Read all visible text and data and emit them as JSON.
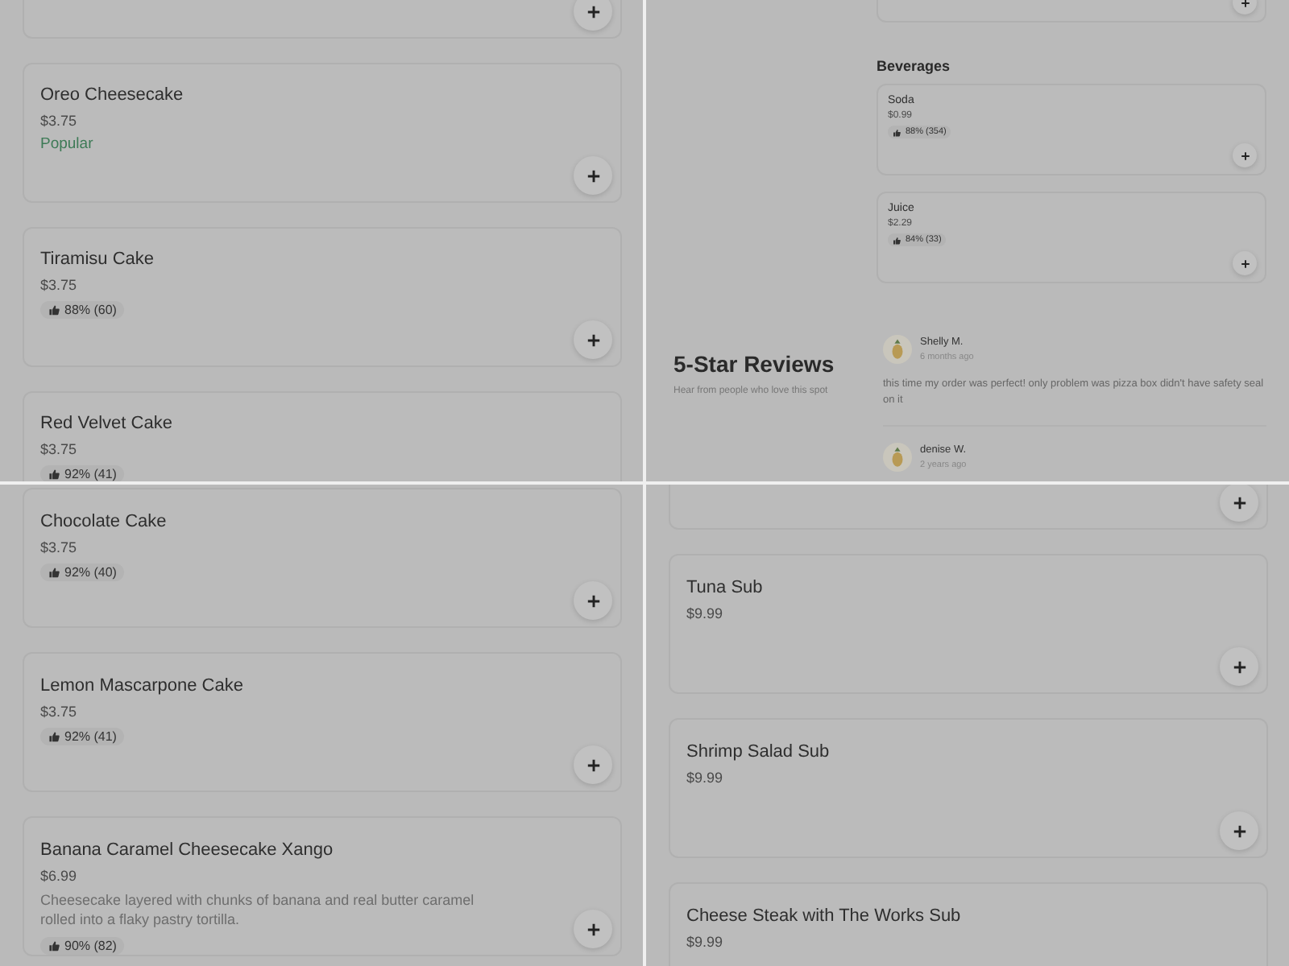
{
  "panels": [
    {
      "kind": "full",
      "blocks": [
        {
          "kind": "cut"
        },
        {
          "kind": "item",
          "name": "Oreo Cheesecake",
          "price": "$3.75",
          "tag": {
            "kind": "label",
            "text": "Popular"
          }
        },
        {
          "kind": "item",
          "name": "Tiramisu Cake",
          "price": "$3.75",
          "tag": {
            "kind": "rating",
            "text": "88% (60)"
          }
        },
        {
          "kind": "item",
          "name": "Red Velvet Cake",
          "price": "$3.75",
          "tag": {
            "kind": "rating",
            "text": "92% (41)"
          }
        }
      ]
    },
    {
      "kind": "split",
      "blocks": [
        {
          "kind": "cut"
        },
        {
          "kind": "heading",
          "text": "Beverages"
        },
        {
          "kind": "item",
          "name": "Soda",
          "price": "$0.99",
          "tag": {
            "kind": "rating",
            "text": "88% (354)"
          }
        },
        {
          "kind": "item",
          "name": "Juice",
          "price": "$2.29",
          "tag": {
            "kind": "rating",
            "text": "84% (33)"
          }
        },
        {
          "kind": "reviews",
          "title": "5-Star Reviews",
          "subtitle": "Hear from people who love this spot",
          "reviews": [
            {
              "author": "Shelly M.",
              "time": "6 months ago",
              "text": "this time my order was perfect! only problem was pizza box didn't have safety seal on it"
            },
            {
              "author": "denise W.",
              "time": "2 years ago"
            }
          ]
        }
      ]
    },
    {
      "kind": "full",
      "blocks": [
        {
          "kind": "item",
          "name": "Chocolate Cake",
          "price": "$3.75",
          "tag": {
            "kind": "rating",
            "text": "92% (40)"
          }
        },
        {
          "kind": "item",
          "name": "Lemon Mascarpone Cake",
          "price": "$3.75",
          "tag": {
            "kind": "rating",
            "text": "92% (41)"
          }
        },
        {
          "kind": "item",
          "name": "Banana Caramel Cheesecake Xango",
          "price": "$6.99",
          "description": "Cheesecake layered with chunks of banana and real butter caramel rolled into a flaky pastry tortilla.",
          "tag": {
            "kind": "rating",
            "text": "90% (82)"
          }
        }
      ]
    },
    {
      "kind": "full",
      "blocks": [
        {
          "kind": "cut"
        },
        {
          "kind": "item",
          "name": "Tuna Sub",
          "price": "$9.99"
        },
        {
          "kind": "item",
          "name": "Shrimp Salad Sub",
          "price": "$9.99"
        },
        {
          "kind": "item",
          "name": "Cheese Steak with The Works Sub",
          "price": "$9.99"
        }
      ]
    }
  ]
}
